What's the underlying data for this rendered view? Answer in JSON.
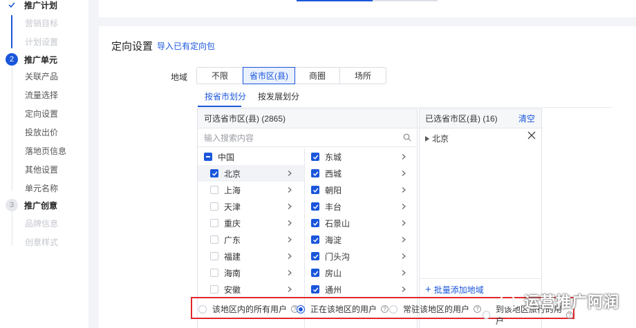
{
  "sidebar": {
    "steps": [
      {
        "number": "",
        "title": "推广计划",
        "items": [
          "营销目标",
          "计划设置"
        ]
      },
      {
        "number": "2",
        "title": "推广单元",
        "items": [
          "关联产品",
          "流量选择",
          "定向设置",
          "投放出价",
          "落地页信息",
          "其他设置",
          "单元名称"
        ]
      },
      {
        "number": "3",
        "title": "推广创意",
        "items": [
          "品牌信息",
          "创意样式"
        ]
      }
    ]
  },
  "section": {
    "title": "定向设置",
    "import_link": "导入已有定向包"
  },
  "region": {
    "label": "地域",
    "options": [
      "不限",
      "省市区(县)",
      "商圈",
      "场所"
    ],
    "selected": "省市区(县)",
    "tabs": [
      "按省市划分",
      "按发展划分"
    ],
    "active_tab": "按省市划分"
  },
  "available": {
    "header": "可选省市区(县) (2865)",
    "search_placeholder": "输入搜索内容",
    "col1": [
      {
        "label": "中国",
        "state": "indeterminate"
      },
      {
        "label": "北京",
        "state": "checked"
      },
      {
        "label": "上海",
        "state": "unchecked"
      },
      {
        "label": "天津",
        "state": "unchecked"
      },
      {
        "label": "重庆",
        "state": "unchecked"
      },
      {
        "label": "广东",
        "state": "unchecked"
      },
      {
        "label": "福建",
        "state": "unchecked"
      },
      {
        "label": "海南",
        "state": "unchecked"
      },
      {
        "label": "安徽",
        "state": "unchecked"
      }
    ],
    "col2": [
      {
        "label": "东城",
        "state": "checked"
      },
      {
        "label": "西城",
        "state": "checked"
      },
      {
        "label": "朝阳",
        "state": "checked"
      },
      {
        "label": "丰台",
        "state": "checked"
      },
      {
        "label": "石景山",
        "state": "checked"
      },
      {
        "label": "海淀",
        "state": "checked"
      },
      {
        "label": "门头沟",
        "state": "checked"
      },
      {
        "label": "房山",
        "state": "checked"
      },
      {
        "label": "通州",
        "state": "checked"
      }
    ]
  },
  "selected_panel": {
    "header": "已选省市区(县) (16)",
    "clear": "清空",
    "items": [
      "北京"
    ],
    "batch_add": "批量添加地域"
  },
  "audience": {
    "options": [
      "该地区内的所有用户",
      "正在该地区的用户",
      "常驻该地区的用户",
      "到该地区旅行的用户"
    ],
    "selected": "正在该地区的用户"
  },
  "watermark": "运营推广阿润",
  "colors": {
    "accent": "#1a56db",
    "highlight_border": "#e0262b"
  }
}
